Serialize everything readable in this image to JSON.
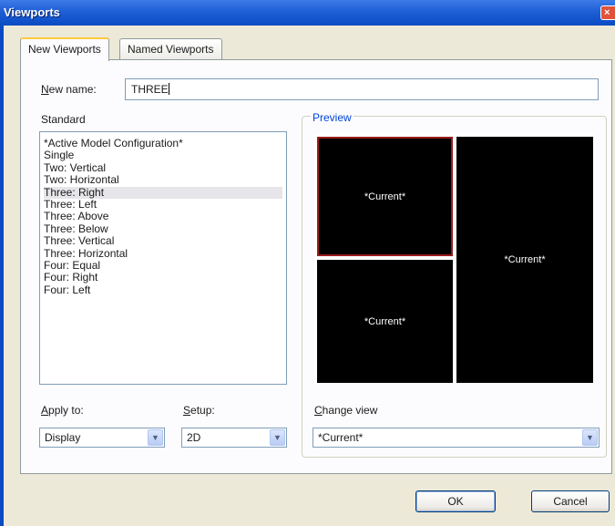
{
  "window": {
    "title": "Viewports",
    "close_glyph": "×"
  },
  "tabs": [
    {
      "label": "New Viewports",
      "active": true
    },
    {
      "label": "Named Viewports",
      "active": false
    }
  ],
  "new_name": {
    "label": "New name:",
    "accel": "N",
    "rest": "ew name:",
    "value": "THREE"
  },
  "standard": {
    "label": "Standard",
    "items": [
      "*Active Model Configuration*",
      "Single",
      "Two:  Vertical",
      "Two:  Horizontal",
      "Three: Right",
      "Three: Left",
      "Three: Above",
      "Three: Below",
      "Three: Vertical",
      "Three: Horizontal",
      "Four:  Equal",
      "Four:  Right",
      "Four:  Left"
    ],
    "selected": "Three: Right"
  },
  "preview": {
    "label": "Preview",
    "viewport_label": "*Current*"
  },
  "apply_to": {
    "label": "Apply to:",
    "accel": "A",
    "rest": "pply to:",
    "value": "Display"
  },
  "setup": {
    "label": "Setup:",
    "accel": "S",
    "rest": "etup:",
    "value": "2D"
  },
  "change_view": {
    "label": "Change view",
    "accel": "C",
    "rest": "hange view",
    "value": "*Current*"
  },
  "buttons": {
    "ok": "OK",
    "cancel": "Cancel"
  },
  "icons": {
    "dropdown": "chevron-down-icon",
    "close": "close-icon"
  }
}
